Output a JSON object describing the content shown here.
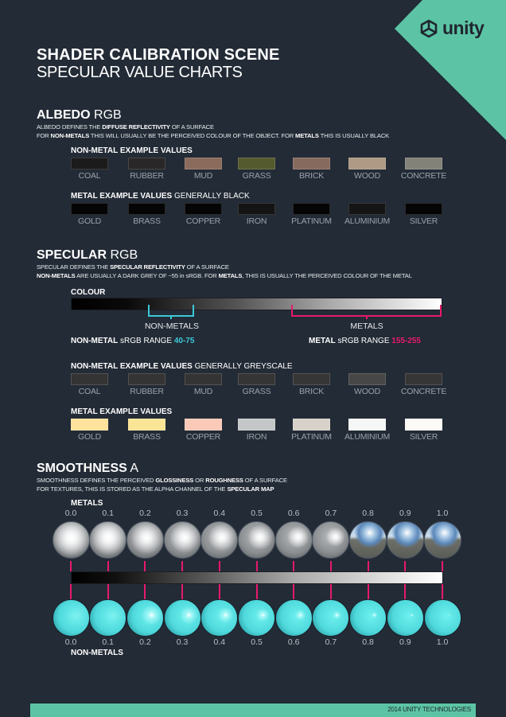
{
  "brand": {
    "logo_text": "unity",
    "accent": "#5cc4a4",
    "highlight_pink": "#e8196b",
    "highlight_cyan": "#3cc8d8",
    "background": "#232b36"
  },
  "header": {
    "title": "SHADER CALIBRATION SCENE",
    "subtitle": "SPECULAR VALUE CHARTS"
  },
  "albedo": {
    "heading_bold": "ALBEDO",
    "heading_light": "RGB",
    "desc_line1": {
      "pre": "ALBEDO DEFINES THE ",
      "bold": "DIFFUSE REFLECTIVITY",
      "post": " OF A SURFACE"
    },
    "desc_line2": {
      "pre": "FOR ",
      "bold1": "NON-METALS",
      "mid": " THIS WILL USUALLY BE THE PERCEIVED COLOUR OF THE OBJECT. FOR ",
      "bold2": "METALS",
      "post": " THIS IS USUALLY BLACK"
    },
    "nonmetal_heading": "NON-METAL EXAMPLE VALUES",
    "nonmetal_swatches": [
      {
        "label": "COAL",
        "color": "#1b1b1b"
      },
      {
        "label": "RUBBER",
        "color": "#292727"
      },
      {
        "label": "MUD",
        "color": "#8a6b5c"
      },
      {
        "label": "GRASS",
        "color": "#555a2e"
      },
      {
        "label": "BRICK",
        "color": "#866a5e"
      },
      {
        "label": "WOOD",
        "color": "#ae9a85"
      },
      {
        "label": "CONCRETE",
        "color": "#838279"
      }
    ],
    "metal_heading_bold": "METAL EXAMPLE VALUES",
    "metal_heading_light": "GENERALLY BLACK",
    "metal_swatches": [
      {
        "label": "GOLD",
        "color": "#050505"
      },
      {
        "label": "BRASS",
        "color": "#050505"
      },
      {
        "label": "COPPER",
        "color": "#050505"
      },
      {
        "label": "IRON",
        "color": "#141414"
      },
      {
        "label": "PLATINUM",
        "color": "#050505"
      },
      {
        "label": "ALUMINIUM",
        "color": "#151515"
      },
      {
        "label": "SILVER",
        "color": "#050505"
      }
    ]
  },
  "specular": {
    "heading_bold": "SPECULAR",
    "heading_light": "RGB",
    "desc_line1": {
      "pre": "SPECULAR DEFINES THE ",
      "bold": "SPECULAR REFLECTIVITY",
      "post": " OF A SURFACE"
    },
    "desc_line2": {
      "bold1": "NON-METALS",
      "mid": " ARE USUALLY A DARK GREY OF ~55 in sRGB. FOR ",
      "bold2": "METALS",
      "post": ", THIS IS USUALLY THE PERCEIVED COLOUR OF THE METAL"
    },
    "colour_label": "COLOUR",
    "nonmetals_label": "NON-METALS",
    "metals_label": "METALS",
    "nonmetal_range": {
      "bold": "NON-METAL",
      "text": " sRGB RANGE ",
      "value": "40-75"
    },
    "metal_range": {
      "bold": "METAL",
      "text": " sRGB RANGE ",
      "value": "155-255"
    },
    "nonmetal_heading_bold": "NON-METAL EXAMPLE VALUES",
    "nonmetal_heading_light": "GENERALLY GREYSCALE",
    "nonmetal_swatches": [
      {
        "label": "COAL",
        "color": "#343434"
      },
      {
        "label": "RUBBER",
        "color": "#343434"
      },
      {
        "label": "MUD",
        "color": "#343434"
      },
      {
        "label": "GRASS",
        "color": "#353535"
      },
      {
        "label": "BRICK",
        "color": "#363636"
      },
      {
        "label": "WOOD",
        "color": "#474747"
      },
      {
        "label": "CONCRETE",
        "color": "#363636"
      }
    ],
    "metal_heading": "METAL EXAMPLE VALUES",
    "metal_swatches": [
      {
        "label": "GOLD",
        "color": "#ffe29b"
      },
      {
        "label": "BRASS",
        "color": "#fae596"
      },
      {
        "label": "COPPER",
        "color": "#fac9b8"
      },
      {
        "label": "IRON",
        "color": "#c4c7c8"
      },
      {
        "label": "PLATINUM",
        "color": "#d6d1c9"
      },
      {
        "label": "ALUMINIUM",
        "color": "#f5f7f7"
      },
      {
        "label": "SILVER",
        "color": "#fbfaf6"
      }
    ]
  },
  "smoothness": {
    "heading_bold": "SMOOTHNESS",
    "heading_light": "A",
    "desc_line1": {
      "pre": "SMOOTHNESS DEFINES THE PERCEIVED ",
      "bold1": "GLOSSINESS",
      "mid": " OR ",
      "bold2": "ROUGHNESS",
      "post": " OF A SURFACE"
    },
    "desc_line2": {
      "pre": "FOR TEXTURES, THIS IS STORED AS THE ALPHA CHANNEL OF THE ",
      "bold": "SPECULAR MAP"
    },
    "metals_label": "METALS",
    "nonmetals_label": "NON-METALS",
    "values": [
      "0.0",
      "0.1",
      "0.2",
      "0.3",
      "0.4",
      "0.5",
      "0.6",
      "0.7",
      "0.8",
      "0.9",
      "1.0"
    ]
  },
  "footer": {
    "text": "2014 UNITY TECHNOLOGIES"
  }
}
